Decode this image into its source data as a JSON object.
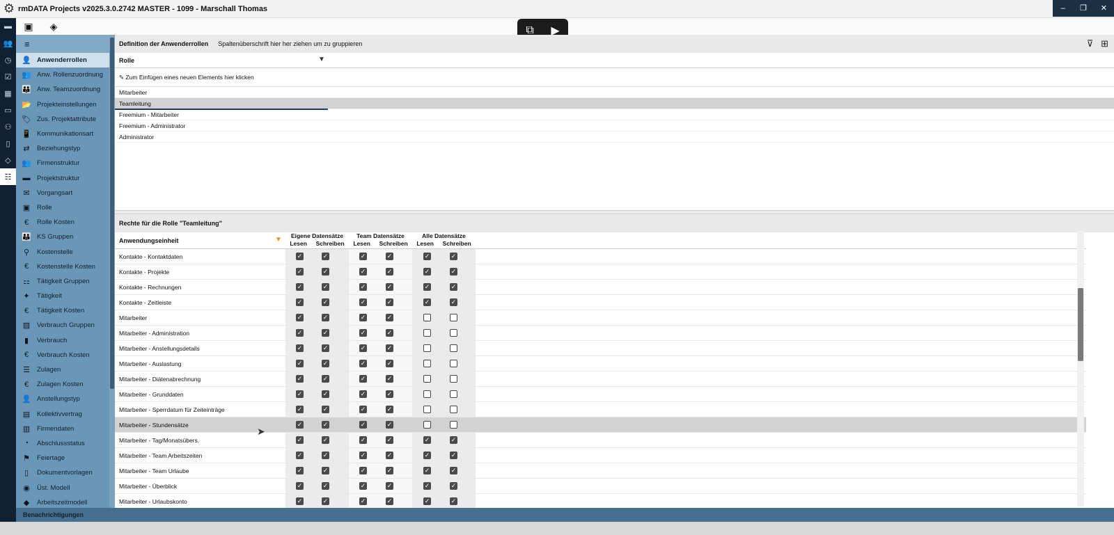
{
  "window": {
    "title": "rmDATA Projects v2025.3.0.2742 MASTER - 1099 - Marschall Thomas",
    "controls": [
      "–",
      "❐",
      "✕"
    ]
  },
  "iconrail": {
    "icons": [
      "folder-icon",
      "contacts-icon",
      "clock-icon",
      "tasks-icon",
      "calendar-icon",
      "money-icon",
      "team-icon",
      "book-icon",
      "tag-icon",
      "settings-icon"
    ]
  },
  "toolbar": {
    "save_icon": "save-icon",
    "eraser_icon": "eraser-icon"
  },
  "sidebar": {
    "items": [
      {
        "label": "Anwenderrollen",
        "icon": "👤",
        "active": true
      },
      {
        "label": "Anw. Rollenzuordnung",
        "icon": "👥"
      },
      {
        "label": "Anw. Teamzuordnung",
        "icon": "👪"
      },
      {
        "label": "Projekteinstellungen",
        "icon": "📂"
      },
      {
        "label": "Zus. Projektattribute",
        "icon": "🏷"
      },
      {
        "label": "Kommunikationsart",
        "icon": "📱"
      },
      {
        "label": "Beziehungstyp",
        "icon": "⇄"
      },
      {
        "label": "Firmenstruktur",
        "icon": "👥"
      },
      {
        "label": "Projektstruktur",
        "icon": "▬"
      },
      {
        "label": "Vorgangsart",
        "icon": "✉"
      },
      {
        "label": "Rolle",
        "icon": "▣"
      },
      {
        "label": "Rolle Kosten",
        "icon": "€"
      },
      {
        "label": "KS Gruppen",
        "icon": "👪"
      },
      {
        "label": "Kostenstelle",
        "icon": "⚲"
      },
      {
        "label": "Kostenstelle Kosten",
        "icon": "€"
      },
      {
        "label": "Tätigkeit Gruppen",
        "icon": "⚏"
      },
      {
        "label": "Tätigkeit",
        "icon": "✦"
      },
      {
        "label": "Tätigkeit Kosten",
        "icon": "€"
      },
      {
        "label": "Verbrauch Gruppen",
        "icon": "▨"
      },
      {
        "label": "Verbrauch",
        "icon": "▮"
      },
      {
        "label": "Verbrauch Kosten",
        "icon": "€"
      },
      {
        "label": "Zulagen",
        "icon": "☰"
      },
      {
        "label": "Zulagen Kosten",
        "icon": "€"
      },
      {
        "label": "Anstellungstyp",
        "icon": "👤"
      },
      {
        "label": "Kollektivvertrag",
        "icon": "▤"
      },
      {
        "label": "Firmendaten",
        "icon": "▥"
      },
      {
        "label": "Abschlussstatus",
        "icon": "◔"
      },
      {
        "label": "Feiertage",
        "icon": "⚑"
      },
      {
        "label": "Dokumentvorlagen",
        "icon": "▯"
      },
      {
        "label": "Üst. Modell",
        "icon": "◉"
      },
      {
        "label": "Arbeitszeitmodell",
        "icon": "◆"
      }
    ]
  },
  "roles_panel": {
    "title": "Definition der Anwenderrollen",
    "group_hint": "Spaltenüberschrift hier her ziehen um zu gruppieren",
    "column": "Rolle",
    "new_row": "Zum Einfügen eines neuen Elements hier klicken",
    "rows": [
      "Mitarbeiter",
      "Teamleitung",
      "Freemium - Mitarbeiter",
      "Freemium - Administrator",
      "Administrator"
    ],
    "selected": "Teamleitung"
  },
  "rights_panel": {
    "title": "Rechte für die Rolle \"Teamleitung\"",
    "column": "Anwendungseinheit",
    "groups": [
      {
        "label": "Eigene Datensätze",
        "read": "Lesen",
        "write": "Schreiben"
      },
      {
        "label": "Team Datensätze",
        "read": "Lesen",
        "write": "Schreiben"
      },
      {
        "label": "Alle Datensätze",
        "read": "Lesen",
        "write": "Schreiben"
      }
    ],
    "rows": [
      {
        "label": "Kontakte - Kontaktdaten",
        "v": [
          1,
          1,
          1,
          1,
          1,
          1
        ]
      },
      {
        "label": "Kontakte - Projekte",
        "v": [
          1,
          1,
          1,
          1,
          1,
          1
        ]
      },
      {
        "label": "Kontakte - Rechnungen",
        "v": [
          1,
          1,
          1,
          1,
          1,
          1
        ]
      },
      {
        "label": "Kontakte - Zeitleiste",
        "v": [
          1,
          1,
          1,
          1,
          1,
          1
        ]
      },
      {
        "label": "Mitarbeiter",
        "v": [
          1,
          1,
          1,
          1,
          0,
          0
        ]
      },
      {
        "label": "Mitarbeiter - Administration",
        "v": [
          1,
          1,
          1,
          1,
          0,
          0
        ]
      },
      {
        "label": "Mitarbeiter - Anstellungsdetails",
        "v": [
          1,
          1,
          1,
          1,
          0,
          0
        ]
      },
      {
        "label": "Mitarbeiter - Auslastung",
        "v": [
          1,
          1,
          1,
          1,
          0,
          0
        ]
      },
      {
        "label": "Mitarbeiter - Diätenabrechnung",
        "v": [
          1,
          1,
          1,
          1,
          0,
          0
        ]
      },
      {
        "label": "Mitarbeiter - Grunddaten",
        "v": [
          1,
          1,
          1,
          1,
          0,
          0
        ]
      },
      {
        "label": "Mitarbeiter - Sperrdatum für Zeiteinträge",
        "v": [
          1,
          1,
          1,
          1,
          0,
          0
        ]
      },
      {
        "label": "Mitarbeiter - Stundensätze",
        "v": [
          1,
          1,
          1,
          1,
          0,
          0
        ],
        "selected": true
      },
      {
        "label": "Mitarbeiter - Tag/Monatsübers.",
        "v": [
          1,
          1,
          1,
          1,
          1,
          1
        ]
      },
      {
        "label": "Mitarbeiter - Team Arbeitszeiten",
        "v": [
          1,
          1,
          1,
          1,
          1,
          1
        ]
      },
      {
        "label": "Mitarbeiter - Team Urlaube",
        "v": [
          1,
          1,
          1,
          1,
          1,
          1
        ]
      },
      {
        "label": "Mitarbeiter - Überblick",
        "v": [
          1,
          1,
          1,
          1,
          1,
          1
        ]
      },
      {
        "label": "Mitarbeiter - Urlaubskonto",
        "v": [
          1,
          1,
          1,
          1,
          1,
          1
        ]
      }
    ]
  },
  "statusbar": {
    "label": "Benachrichtigungen"
  }
}
